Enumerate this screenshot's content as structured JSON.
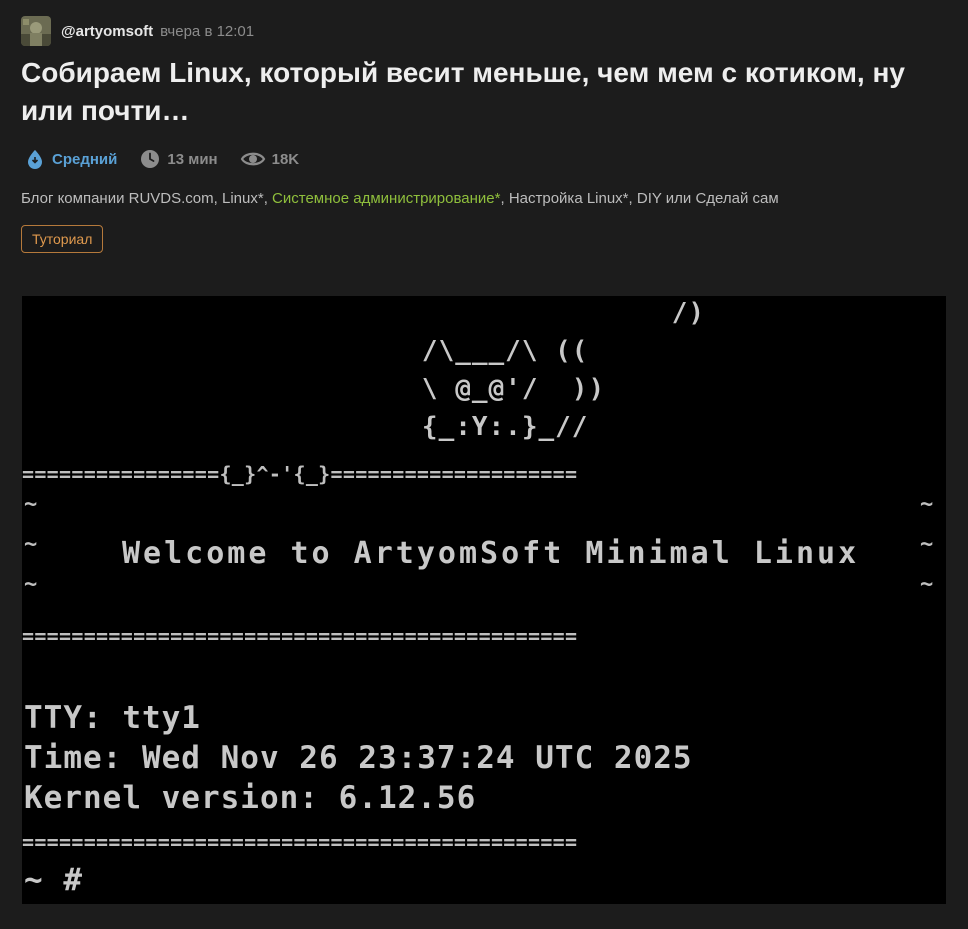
{
  "post": {
    "author": "@artyomsoft",
    "time": "вчера в 12:01",
    "title": "Собираем Linux, который весит меньше, чем мем с котиком, ну или почти…",
    "difficulty": "Средний",
    "reading_time": "13 мин",
    "views": "18K",
    "hubs": [
      {
        "label": "Блог компании RUVDS.com",
        "sep": ", "
      },
      {
        "label": "Linux*",
        "sep": ", "
      },
      {
        "label": "Системное администрирование*",
        "sep": ", "
      },
      {
        "label": "Настройка Linux*",
        "sep": ", "
      },
      {
        "label": "DIY или Сделай сам",
        "sep": ""
      }
    ],
    "tag": "Туториал"
  },
  "colors": {
    "background": "#1c1c1c",
    "difficulty": "#5aa1d6",
    "highlighted_hub": "#8fbf3c",
    "tag": "#e09a4e"
  },
  "icons": {
    "difficulty": "drop-icon",
    "reading_time": "clock-icon",
    "views": "eye-icon"
  },
  "terminal": {
    "art": [
      "                     /)",
      "      /\\___/\\ ((",
      "      \\ @_@'/  ))",
      "      {_:Y:.}_//"
    ],
    "separator_cat": "================{_}^-'{_}====================",
    "separator": "=============================================",
    "tilde": "~",
    "welcome": "Welcome to ArtyomSoft Minimal Linux",
    "tty": "TTY: tty1",
    "time": "Time: Wed Nov 26 23:37:24 UTC 2025",
    "kernel": "Kernel version: 6.12.56",
    "prompt": "~ #"
  }
}
